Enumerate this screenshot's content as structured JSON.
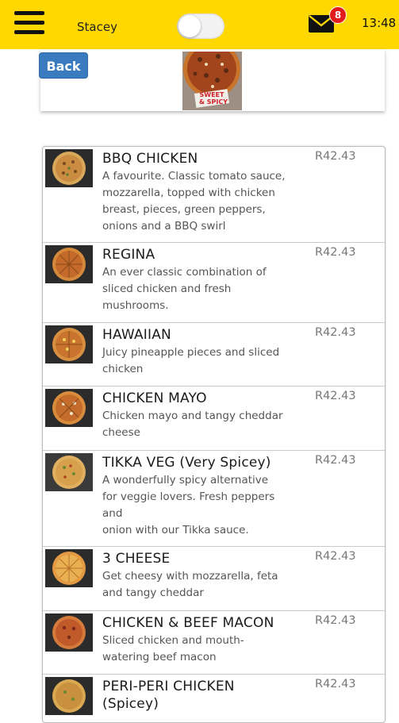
{
  "topbar": {
    "username": "Stacey",
    "notification_count": "8",
    "time": "13:48"
  },
  "header": {
    "back_label": "Back",
    "hero_image": "sweet-and-spicy-pizza-banner",
    "hero_text": "SWEET & SPICY"
  },
  "menu": {
    "items": [
      {
        "name": "BBQ CHICKEN",
        "price": "R42.43",
        "description": [
          "A favourite. Classic tomato sauce,",
          "mozzarella, topped with chicken",
          "breast, pieces, green peppers,",
          "onions and a BBQ swirl"
        ]
      },
      {
        "name": "REGINA",
        "price": "R42.43",
        "description": [
          "An ever classic combination of",
          "sliced chicken and fresh",
          "mushrooms."
        ]
      },
      {
        "name": "HAWAIIAN",
        "price": "R42.43",
        "description": [
          "Juicy pineapple pieces and sliced",
          "chicken"
        ]
      },
      {
        "name": "CHICKEN MAYO",
        "price": "R42.43",
        "description": [
          "Chicken mayo and tangy cheddar",
          "cheese"
        ]
      },
      {
        "name": "TIKKA VEG (Very Spicey)",
        "price": "R42.43",
        "description": [
          "A wonderfully spicy alternative",
          "for veggie lovers. Fresh peppers",
          "and",
          "onion with our Tikka sauce."
        ]
      },
      {
        "name": "3 CHEESE",
        "price": "R42.43",
        "description": [
          "Get cheesy with mozzarella, feta",
          "and tangy cheddar"
        ]
      },
      {
        "name": "CHICKEN & BEEF MACON",
        "price": "R42.43",
        "description": [
          "Sliced chicken and mouth-",
          "watering beef macon"
        ]
      },
      {
        "name": "PERI-PERI CHICKEN",
        "name2": "(Spicey)",
        "price": "R42.43",
        "description": []
      }
    ]
  },
  "colors": {
    "topbar": "#ffd800",
    "back_button": "#3a7bbf",
    "badge": "#e21b1b"
  },
  "icons": {
    "menu": "hamburger-icon",
    "mail": "envelope-icon",
    "toggle": "toggle-switch"
  }
}
